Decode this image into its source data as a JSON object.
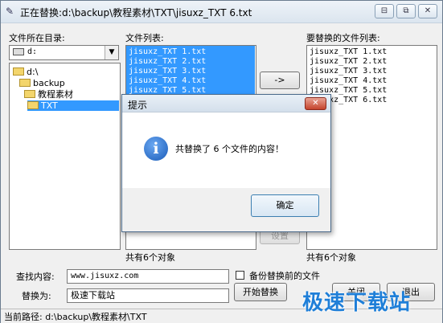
{
  "window": {
    "title": "正在替换:d:\\backup\\教程素材\\TXT\\jisuxz_TXT 6.txt",
    "buttons": [
      "⊟",
      "⧉",
      "✕"
    ]
  },
  "left": {
    "heading": "文件所在目录:",
    "drive": "d:",
    "tree": [
      "d:\\",
      "backup",
      "教程素材",
      "TXT"
    ]
  },
  "middle": {
    "heading": "文件列表:",
    "files": [
      "jisuxz_TXT 1.txt",
      "jisuxz_TXT 2.txt",
      "jisuxz_TXT 3.txt",
      "jisuxz_TXT 4.txt",
      "jisuxz_TXT 5.txt"
    ],
    "count": "共有6个对象"
  },
  "right": {
    "heading": "要替换的文件列表:",
    "files": [
      "jisuxz_TXT 1.txt",
      "jisuxz_TXT 2.txt",
      "jisuxz_TXT 3.txt",
      "jisuxz_TXT 4.txt",
      "jisuxz_TXT 5.txt",
      "jisuxz_TXT 6.txt"
    ],
    "count": "共有6个对象"
  },
  "buttons": {
    "add": "->",
    "settings": "设置",
    "start": "开始替换",
    "close": "关闭",
    "exit": "退出"
  },
  "form": {
    "find_label": "查找内容:",
    "find_value": "www.jisuxz.com",
    "replace_label": "替换为:",
    "replace_value": "极速下载站",
    "backup_label": "备份替换前的文件"
  },
  "status": {
    "path": "当前路径: d:\\backup\\教程素材\\TXT"
  },
  "dialog": {
    "title": "提示",
    "close": "✕",
    "message": "共替换了 6 个文件的内容！",
    "ok": "确定"
  },
  "watermark": "极速下载站",
  "colors": {
    "selection": "#3399ff",
    "watermark": "#1f7fd8"
  }
}
